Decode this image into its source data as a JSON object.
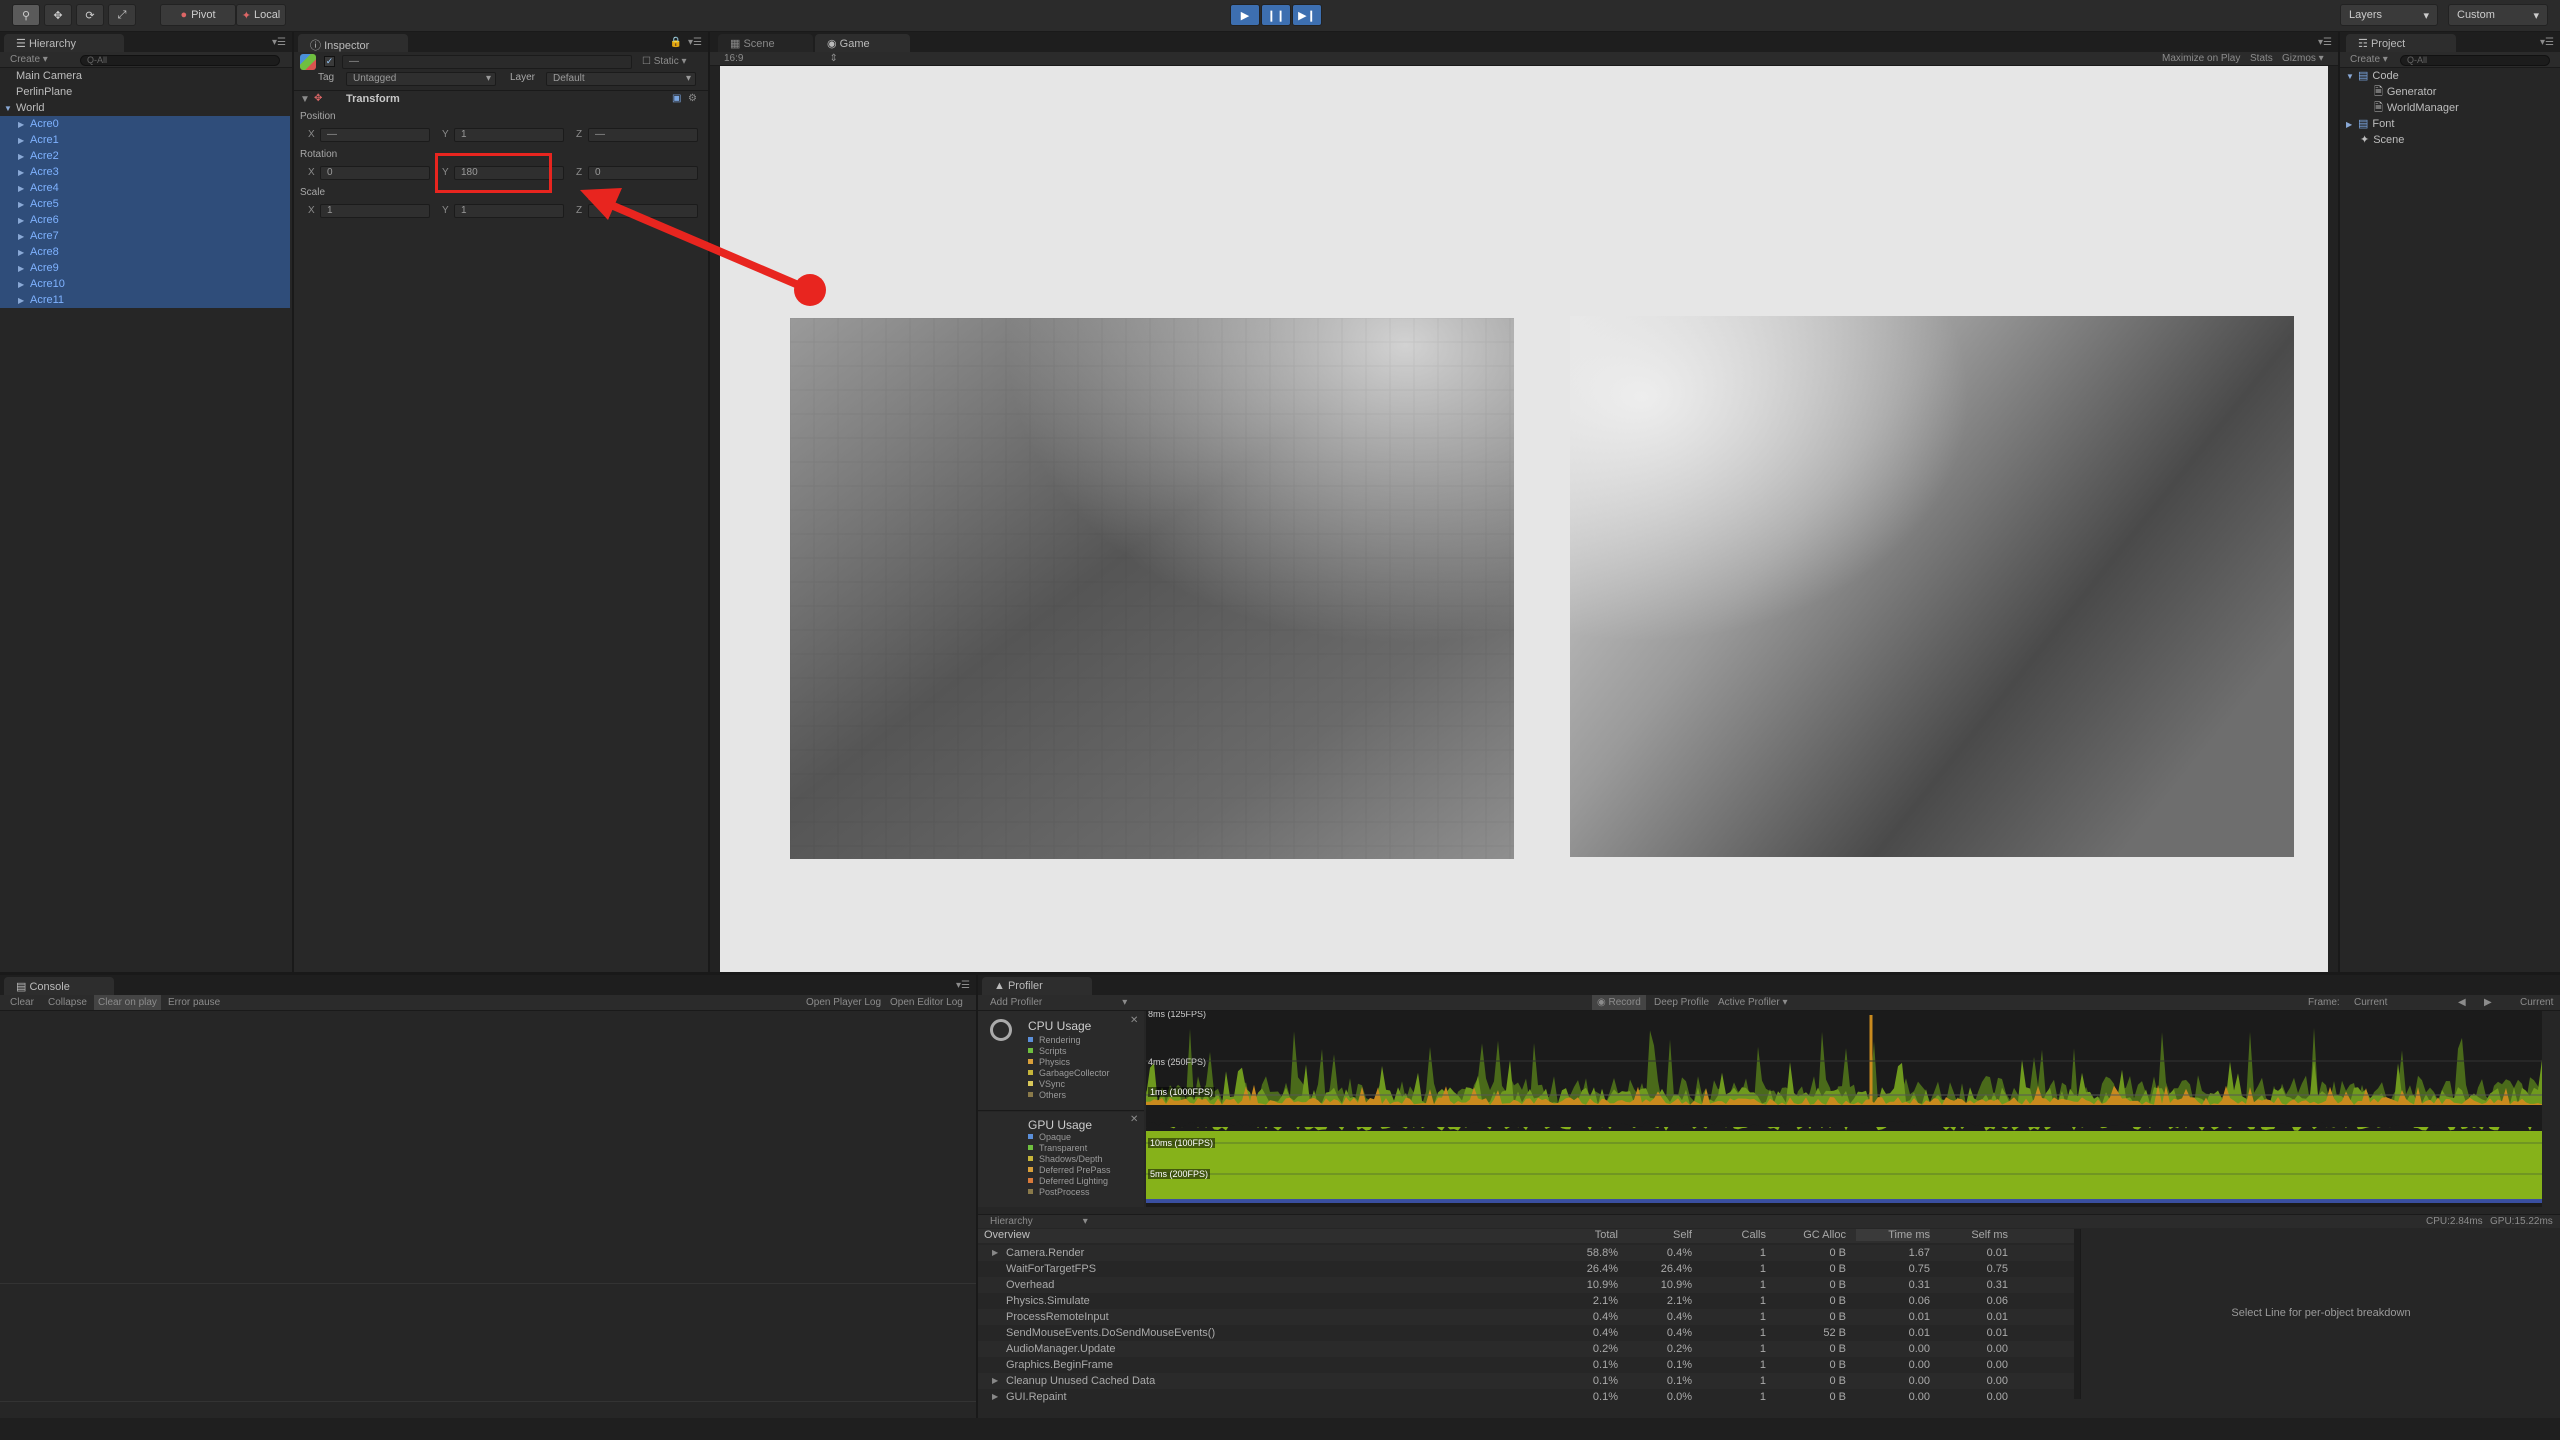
{
  "toolbar": {
    "tools": [
      "hand",
      "move",
      "rotate",
      "scale"
    ],
    "pivot": "Pivot",
    "local": "Local",
    "layers": "Layers",
    "layout": "Custom"
  },
  "hierarchy": {
    "tab": "Hierarchy",
    "create": "Create",
    "search_placeholder": "Q-All",
    "items": [
      "Main Camera",
      "PerlinPlane",
      "World"
    ],
    "children": [
      "Acre0",
      "Acre1",
      "Acre2",
      "Acre3",
      "Acre4",
      "Acre5",
      "Acre6",
      "Acre7",
      "Acre8",
      "Acre9",
      "Acre10",
      "Acre11"
    ]
  },
  "inspector": {
    "tab": "Inspector",
    "static": "Static",
    "name_placeholder": "—",
    "tag_label": "Tag",
    "tag_value": "Untagged",
    "layer_label": "Layer",
    "layer_value": "Default",
    "component": "Transform",
    "position_label": "Position",
    "rotation_label": "Rotation",
    "scale_label": "Scale",
    "axis_x": "X",
    "axis_y": "Y",
    "axis_z": "Z",
    "position": {
      "x": "—",
      "y": "1",
      "z": "—"
    },
    "rotation": {
      "x": "0",
      "y": "180",
      "z": "0"
    },
    "scale": {
      "x": "1",
      "y": "1",
      "z": ""
    }
  },
  "game": {
    "tab_scene": "Scene",
    "tab_game": "Game",
    "aspect": "16:9",
    "maximize": "Maximize on Play",
    "stats": "Stats",
    "gizmos": "Gizmos"
  },
  "project": {
    "tab": "Project",
    "create": "Create",
    "search_placeholder": "Q-All",
    "items": [
      {
        "label": "Code",
        "icon": "folder-icon"
      },
      {
        "label": "Generator",
        "icon": "script-icon"
      },
      {
        "label": "WorldManager",
        "icon": "script-icon"
      },
      {
        "label": "Font",
        "icon": "folder-icon"
      },
      {
        "label": "Scene",
        "icon": "unity-scene-icon"
      }
    ]
  },
  "console": {
    "tab": "Console",
    "buttons": [
      "Clear",
      "Collapse",
      "Clear on play",
      "Error pause"
    ],
    "right_buttons": [
      "Open Player Log",
      "Open Editor Log"
    ]
  },
  "profiler": {
    "tab": "Profiler",
    "add": "Add Profiler",
    "record": "Record",
    "deep": "Deep Profile",
    "active": "Active Profiler",
    "frame_label": "Frame:",
    "frame_value": "Current",
    "current_btn": "Current",
    "cpu_title": "CPU Usage",
    "cpu_legend": [
      {
        "label": "Rendering",
        "color": "#5b8fd9"
      },
      {
        "label": "Scripts",
        "color": "#6fbf3f"
      },
      {
        "label": "Physics",
        "color": "#d9a03a"
      },
      {
        "label": "GarbageCollector",
        "color": "#c6b53a"
      },
      {
        "label": "VSync",
        "color": "#d9c85a"
      },
      {
        "label": "Others",
        "color": "#8a7a4a"
      }
    ],
    "gpu_title": "GPU Usage",
    "gpu_legend": [
      {
        "label": "Opaque",
        "color": "#5b8fd9"
      },
      {
        "label": "Transparent",
        "color": "#6fbf3f"
      },
      {
        "label": "Shadows/Depth",
        "color": "#c6b53a"
      },
      {
        "label": "Deferred PrePass",
        "color": "#d9a03a"
      },
      {
        "label": "Deferred Lighting",
        "color": "#d97a3a"
      },
      {
        "label": "PostProcess",
        "color": "#8a7a4a"
      }
    ],
    "cpu_labels": [
      "8ms (125FPS)",
      "4ms (250FPS)",
      "1ms (1000FPS)"
    ],
    "gpu_labels": [
      "10ms (100FPS)",
      "5ms (200FPS)"
    ],
    "view_mode": "Hierarchy",
    "cpu_time": "CPU:2.84ms",
    "gpu_time": "GPU:15.22ms",
    "columns": [
      "Overview",
      "Total",
      "Self",
      "Calls",
      "GC Alloc",
      "Time ms",
      "Self ms"
    ],
    "rows": [
      {
        "name": "Camera.Render",
        "expand": true,
        "total": "58.8%",
        "self": "0.4%",
        "calls": "1",
        "gc": "0 B",
        "time": "1.67",
        "selfms": "0.01"
      },
      {
        "name": "WaitForTargetFPS",
        "expand": false,
        "total": "26.4%",
        "self": "26.4%",
        "calls": "1",
        "gc": "0 B",
        "time": "0.75",
        "selfms": "0.75"
      },
      {
        "name": "Overhead",
        "expand": false,
        "total": "10.9%",
        "self": "10.9%",
        "calls": "1",
        "gc": "0 B",
        "time": "0.31",
        "selfms": "0.31"
      },
      {
        "name": "Physics.Simulate",
        "expand": false,
        "total": "2.1%",
        "self": "2.1%",
        "calls": "1",
        "gc": "0 B",
        "time": "0.06",
        "selfms": "0.06"
      },
      {
        "name": "ProcessRemoteInput",
        "expand": false,
        "total": "0.4%",
        "self": "0.4%",
        "calls": "1",
        "gc": "0 B",
        "time": "0.01",
        "selfms": "0.01"
      },
      {
        "name": "SendMouseEvents.DoSendMouseEvents()",
        "expand": false,
        "total": "0.4%",
        "self": "0.4%",
        "calls": "1",
        "gc": "52 B",
        "time": "0.01",
        "selfms": "0.01"
      },
      {
        "name": "AudioManager.Update",
        "expand": false,
        "total": "0.2%",
        "self": "0.2%",
        "calls": "1",
        "gc": "0 B",
        "time": "0.00",
        "selfms": "0.00"
      },
      {
        "name": "Graphics.BeginFrame",
        "expand": false,
        "total": "0.1%",
        "self": "0.1%",
        "calls": "1",
        "gc": "0 B",
        "time": "0.00",
        "selfms": "0.00"
      },
      {
        "name": "Cleanup Unused Cached Data",
        "expand": true,
        "total": "0.1%",
        "self": "0.1%",
        "calls": "1",
        "gc": "0 B",
        "time": "0.00",
        "selfms": "0.00"
      },
      {
        "name": "GUI.Repaint",
        "expand": true,
        "total": "0.1%",
        "self": "0.0%",
        "calls": "1",
        "gc": "0 B",
        "time": "0.00",
        "selfms": "0.00"
      }
    ],
    "detail": "Select Line for per-object breakdown"
  },
  "colors": {
    "accent": "#3d6fb0",
    "selection": "#2f4d7a",
    "highlight": "#e8251f"
  }
}
